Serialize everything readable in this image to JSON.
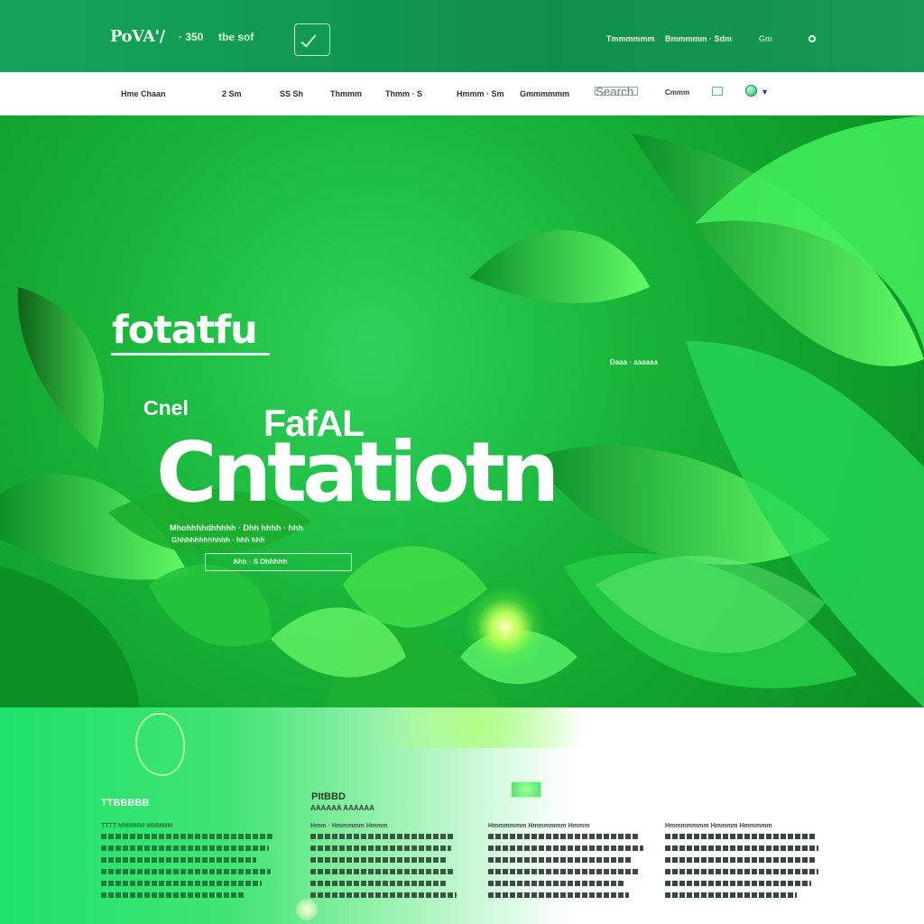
{
  "header": {
    "logo": "PoVA'/",
    "logo_suffix": "· 350",
    "center_text": "tbe sof",
    "icon": "doc-check-icon",
    "right_links": [
      "Tmmmmmm",
      "Bmmmmm · Sdm",
      "Gm"
    ],
    "status_icon": "status-dot-icon"
  },
  "nav": {
    "items": [
      "Hme Chaan",
      "2 Sm",
      "SS Sh",
      "Thmmm",
      "Thmm · S",
      "Hmmm · Sm",
      "Gmmmmmm"
    ],
    "search_placeholder": "Search",
    "small_label": "Cmmm",
    "box_icon": "window-icon",
    "avatar_icon": "avatar-icon",
    "caret_icon": "caret-icon"
  },
  "hero": {
    "small_title": "fotatfu",
    "label": "Cnel",
    "subtitle": "FafAL",
    "title": "Cntatiotn",
    "tag": "Daaa · aaaaaa",
    "line1": "Mhohhhhdhhhhh · Dhh hhhh · hhh",
    "line2": "Ghhhhhhhhhhhh · hhh hhh",
    "button": "Ahh · S Dhhhhh",
    "glow_icon": "sun-glow-icon"
  },
  "lower": {
    "section_label": "TTBBBBB",
    "section_title": "PItBBD",
    "section_sub": "AAAAAA AAAAAA",
    "columns": [
      {
        "heading": "TTTT MMMMM MMMMM",
        "lines": 6
      },
      {
        "heading": "Hmm · Hmmmmm Hmmm",
        "lines": 6
      },
      {
        "heading": "Hmmmmmm Hmmmmmm Hmmm",
        "lines": 6
      },
      {
        "heading": "Hmmmmmmm Hmmmm Hmmmmm",
        "lines": 6
      }
    ]
  },
  "colors": {
    "primary": "#15a45a",
    "hero_green": "#17b338",
    "deep_green": "#0a8c22",
    "white": "#ffffff"
  }
}
